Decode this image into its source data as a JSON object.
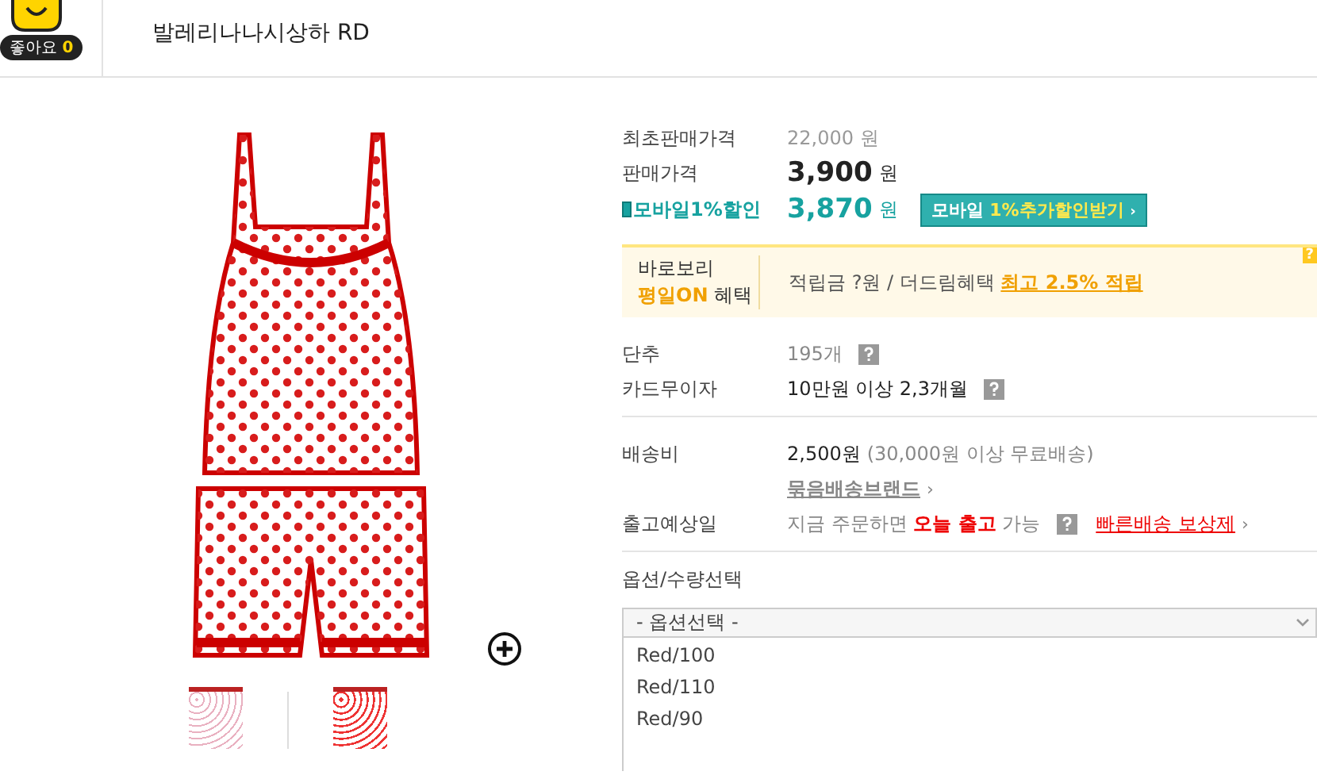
{
  "header": {
    "like_label": "좋아요",
    "like_count": "0",
    "product_name": "발레리나나시상하 RD"
  },
  "prices": {
    "original_label": "최초판매가격",
    "original_value": "22,000 원",
    "sale_label": "판매가격",
    "sale_value": "3,900",
    "sale_unit": "원",
    "mobile_label": "모바일1%할인",
    "mobile_value": "3,870",
    "mobile_unit": "원",
    "mobile_button": {
      "text": "모바일",
      "highlight": "1%추가할인받기",
      "arrow": "›"
    }
  },
  "benefit": {
    "title": "바로보리",
    "badge": "평일ON",
    "badge_suffix": "혜택",
    "text": "적립금 ?원 / 더드림혜택",
    "link": "최고 2.5% 적립",
    "corner": "?"
  },
  "info_rows": [
    {
      "label": "단추",
      "value": "195개",
      "kind": "muted",
      "help": true
    },
    {
      "label": "카드무이자",
      "value": "10만원 이상 2,3개월",
      "kind": "plain",
      "help": true
    }
  ],
  "shipping": {
    "label": "배송비",
    "value": "2,500원",
    "note": "(30,000원 이상 무료배송)",
    "bundle_link": "묶음배송브랜드",
    "bundle_arrow": "›"
  },
  "release": {
    "label": "출고예상일",
    "text": "지금 주문하면 **오늘 출고** 가능",
    "help": true,
    "link": "빠른배송 보상제",
    "arrow": "›"
  },
  "options": {
    "label": "옵션/수량선택",
    "placeholder": "- 옵션선택 -",
    "items": [
      "Red/100",
      "Red/110",
      "Red/90"
    ]
  }
}
